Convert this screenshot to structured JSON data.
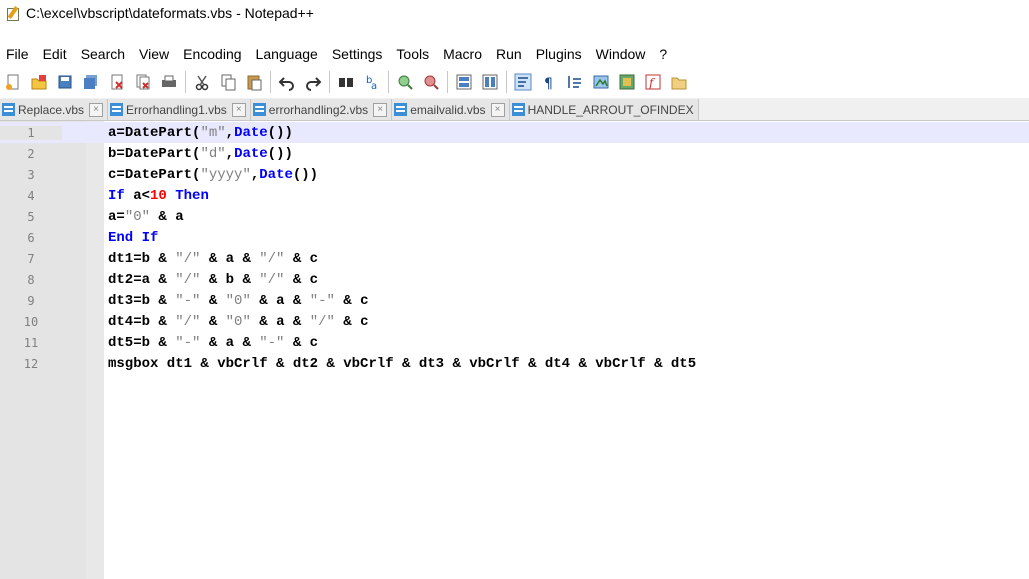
{
  "window": {
    "title": "C:\\excel\\vbscript\\dateformats.vbs - Notepad++"
  },
  "menu": [
    "File",
    "Edit",
    "Search",
    "View",
    "Encoding",
    "Language",
    "Settings",
    "Tools",
    "Macro",
    "Run",
    "Plugins",
    "Window",
    "?"
  ],
  "toolbar": {
    "groups": [
      [
        "new-file-icon",
        "open-file-icon",
        "save-icon",
        "save-all-icon",
        "close-icon",
        "close-all-icon",
        "print-icon"
      ],
      [
        "cut-icon",
        "copy-icon",
        "paste-icon"
      ],
      [
        "undo-icon",
        "redo-icon"
      ],
      [
        "find-icon",
        "replace-icon"
      ],
      [
        "zoom-in-icon",
        "zoom-out-icon"
      ],
      [
        "sync-vertical-icon",
        "sync-horizontal-icon"
      ],
      [
        "word-wrap-icon",
        "show-all-chars-icon",
        "indent-guide-icon",
        "udl-icon",
        "doc-map-icon",
        "function-list-icon",
        "folder-workspace-icon"
      ]
    ]
  },
  "tabs": [
    {
      "label": "Replace.vbs",
      "active": false
    },
    {
      "label": "Errorhandling1.vbs",
      "active": false
    },
    {
      "label": "errorhandling2.vbs",
      "active": false
    },
    {
      "label": "emailvalid.vbs",
      "active": false
    },
    {
      "label": "HANDLE_ARROUT_OFINDEX",
      "active": false
    }
  ],
  "editor": {
    "current_line": 1,
    "lines": [
      {
        "n": "1",
        "tokens": [
          [
            "default",
            "a="
          ],
          [
            "default",
            "DatePart"
          ],
          [
            "op",
            "("
          ],
          [
            "string",
            "\"m\""
          ],
          [
            "op",
            ","
          ],
          [
            "func",
            "Date"
          ],
          [
            "op",
            "())"
          ]
        ]
      },
      {
        "n": "2",
        "tokens": [
          [
            "default",
            "b="
          ],
          [
            "default",
            "DatePart"
          ],
          [
            "op",
            "("
          ],
          [
            "string",
            "\"d\""
          ],
          [
            "op",
            ","
          ],
          [
            "func",
            "Date"
          ],
          [
            "op",
            "())"
          ]
        ]
      },
      {
        "n": "3",
        "tokens": [
          [
            "default",
            "c="
          ],
          [
            "default",
            "DatePart"
          ],
          [
            "op",
            "("
          ],
          [
            "string",
            "\"yyyy\""
          ],
          [
            "op",
            ","
          ],
          [
            "func",
            "Date"
          ],
          [
            "op",
            "())"
          ]
        ]
      },
      {
        "n": "4",
        "tokens": [
          [
            "keyword",
            "If"
          ],
          [
            "default",
            " a<"
          ],
          [
            "number",
            "10"
          ],
          [
            "default",
            " "
          ],
          [
            "keyword",
            "Then"
          ]
        ]
      },
      {
        "n": "5",
        "tokens": [
          [
            "default",
            "a="
          ],
          [
            "string",
            "\"0\""
          ],
          [
            "default",
            " & a"
          ]
        ]
      },
      {
        "n": "6",
        "tokens": [
          [
            "keyword",
            "End If"
          ]
        ]
      },
      {
        "n": "7",
        "tokens": [
          [
            "default",
            "dt1=b & "
          ],
          [
            "string",
            "\"/\""
          ],
          [
            "default",
            " & a & "
          ],
          [
            "string",
            "\"/\""
          ],
          [
            "default",
            " & c"
          ]
        ]
      },
      {
        "n": "8",
        "tokens": [
          [
            "default",
            "dt2=a & "
          ],
          [
            "string",
            "\"/\""
          ],
          [
            "default",
            " & b & "
          ],
          [
            "string",
            "\"/\""
          ],
          [
            "default",
            " & c"
          ]
        ]
      },
      {
        "n": "9",
        "tokens": [
          [
            "default",
            "dt3=b & "
          ],
          [
            "string",
            "\"-\""
          ],
          [
            "default",
            " & "
          ],
          [
            "string",
            "\"0\""
          ],
          [
            "default",
            " & a & "
          ],
          [
            "string",
            "\"-\""
          ],
          [
            "default",
            " & c"
          ]
        ]
      },
      {
        "n": "10",
        "tokens": [
          [
            "default",
            "dt4=b & "
          ],
          [
            "string",
            "\"/\""
          ],
          [
            "default",
            " & "
          ],
          [
            "string",
            "\"0\""
          ],
          [
            "default",
            " & a & "
          ],
          [
            "string",
            "\"/\""
          ],
          [
            "default",
            " & c"
          ]
        ]
      },
      {
        "n": "11",
        "tokens": [
          [
            "default",
            "dt5=b & "
          ],
          [
            "string",
            "\"-\""
          ],
          [
            "default",
            " & a & "
          ],
          [
            "string",
            "\"-\""
          ],
          [
            "default",
            " & c"
          ]
        ]
      },
      {
        "n": "12",
        "tokens": [
          [
            "default",
            "msgbox dt1 & vbCrlf & dt2 & vbCrlf & dt3 & vbCrlf & dt4 & vbCrlf & dt5"
          ]
        ]
      }
    ]
  }
}
